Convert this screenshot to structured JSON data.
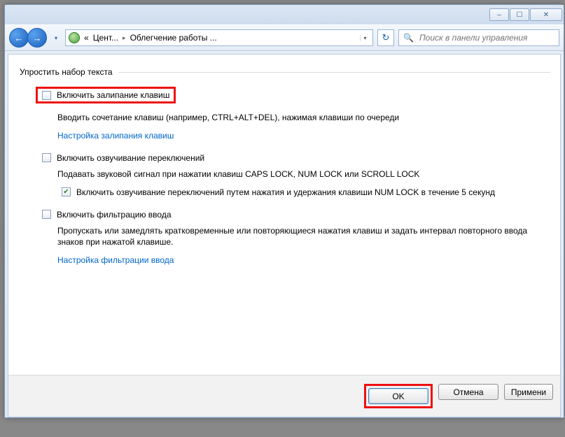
{
  "titlebar": {
    "minimize_icon": "–",
    "maximize_icon": "☐",
    "close_icon": "✕"
  },
  "nav": {
    "back_icon": "←",
    "forward_icon": "→",
    "history_dd_icon": "▾",
    "refresh_icon": "↻"
  },
  "breadcrumb": {
    "sep_prefix": "«",
    "item1": "Цент...",
    "sep": "▸",
    "item2": "Облегчение работы ...",
    "dd_icon": "▾"
  },
  "search": {
    "icon": "🔍",
    "placeholder": "Поиск в панели управления"
  },
  "group": {
    "title": "Упростить набор текста"
  },
  "sticky": {
    "enable_label": "Включить залипание клавиш",
    "desc": "Вводить сочетание клавиш (например, CTRL+ALT+DEL), нажимая клавиши по очереди",
    "settings_link": "Настройка залипания клавиш"
  },
  "toggle": {
    "enable_label": "Включить озвучивание переключений",
    "desc": "Подавать звуковой сигнал при нажатии клавиш CAPS LOCK, NUM LOCK или SCROLL LOCK",
    "sub_label": "Включить озвучивание переключений путем нажатия и удержания клавиши NUM LOCK в течение 5 секунд"
  },
  "filter": {
    "enable_label": "Включить фильтрацию ввода",
    "desc": "Пропускать или замедлять кратковременные или повторяющиеся нажатия клавиш и задать интервал повторного ввода знаков при нажатой клавише.",
    "settings_link": "Настройка фильтрации ввода"
  },
  "buttons": {
    "ok": "OK",
    "cancel": "Отмена",
    "apply": "Примени"
  }
}
